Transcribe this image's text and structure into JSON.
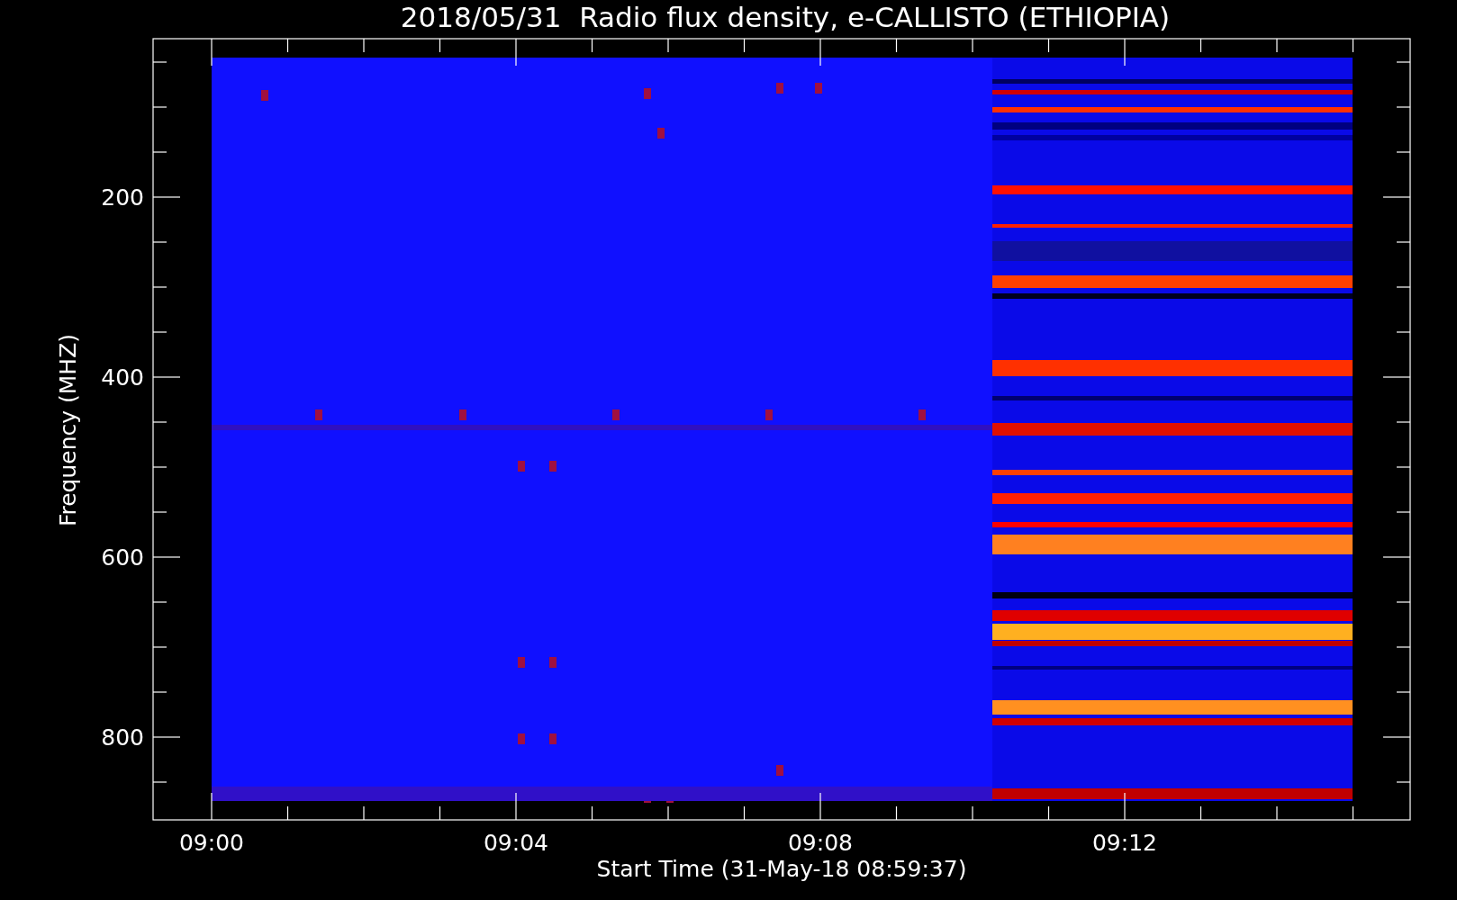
{
  "title": "2018/05/31  Radio flux density, e-CALLISTO (ETHIOPIA)",
  "y_axis": {
    "label": "Frequency (MHZ)",
    "ticks": [
      "200",
      "400",
      "600",
      "800"
    ]
  },
  "x_axis": {
    "label": "Start Time (31-May-18 08:59:37)",
    "ticks": [
      "09:00",
      "09:04",
      "09:08",
      "09:12"
    ]
  }
}
